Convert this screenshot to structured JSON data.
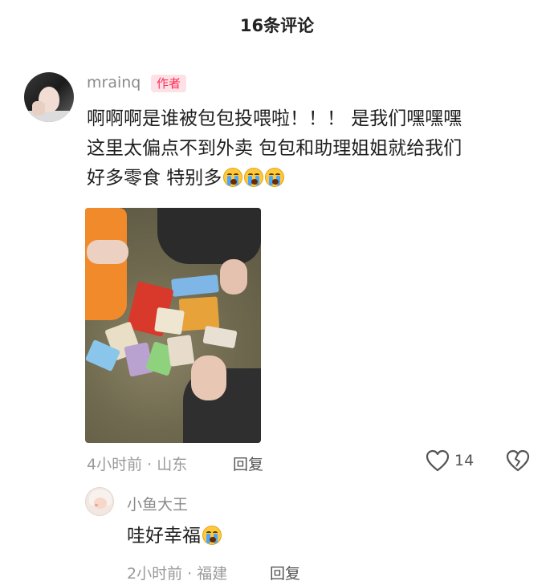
{
  "header": {
    "title": "16条评论"
  },
  "comment": {
    "username": "mrainq",
    "badge": "作者",
    "text_line1": "啊啊啊是谁被包包投喂啦！！！ 是我们嘿嘿嘿",
    "text_line2": "这里太偏点不到外卖 包包和助理姐姐就给我们",
    "text_line3": "好多零食 特别多",
    "emoji_name": "crying-face-emoji",
    "time_location": "4小时前 · 山东",
    "reply_label": "回复",
    "like_count": "14"
  },
  "reply": {
    "username": "小鱼大王",
    "text": "哇好幸福",
    "emoji_name": "crying-face-emoji",
    "time_location": "2小时前 · 福建",
    "reply_label": "回复"
  },
  "colors": {
    "badge_bg": "#fde1e6",
    "badge_text": "#ff2c55",
    "meta_gray": "#9a9a9a"
  },
  "icons": {
    "like": "heart-outline-icon",
    "dislike": "broken-heart-icon"
  }
}
